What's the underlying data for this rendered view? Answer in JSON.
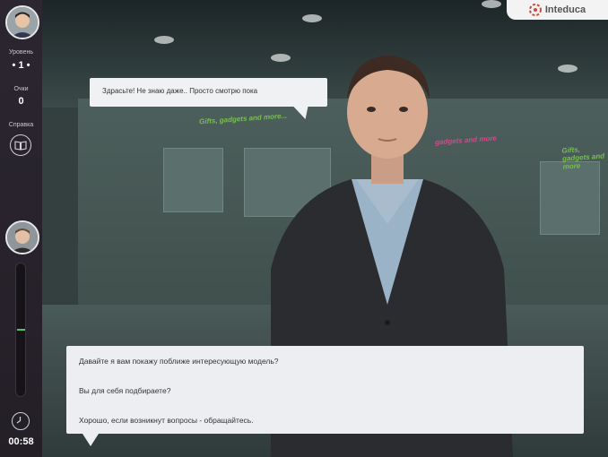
{
  "sidebar": {
    "level_label": "Уровень",
    "level_value": "• 1 •",
    "points_label": "Очки",
    "points_value": "0",
    "help_label": "Справка",
    "help_icon": "book-icon",
    "timer": "00:58",
    "mood_level": 0.5
  },
  "logo": {
    "text": "Inteduca"
  },
  "scene": {
    "store_text_1": "Gifts, gadgets and more...",
    "store_text_2": "gadgets and more",
    "store_text_3": "Gifts, gadgets and more"
  },
  "speech": {
    "text": "Здрасьте! Не знаю даже.. Просто смотрю пока"
  },
  "options": [
    {
      "text": "Давайте я вам покажу поближе интересующую модель?"
    },
    {
      "text": "Вы для себя подбираете?"
    },
    {
      "text": "Хорошо, если возникнут вопросы - обращайтесь."
    }
  ],
  "colors": {
    "sidebar_bg": "#2b2630",
    "meter_mark": "#4fc46a",
    "bubble_bg": "#eceef1"
  }
}
